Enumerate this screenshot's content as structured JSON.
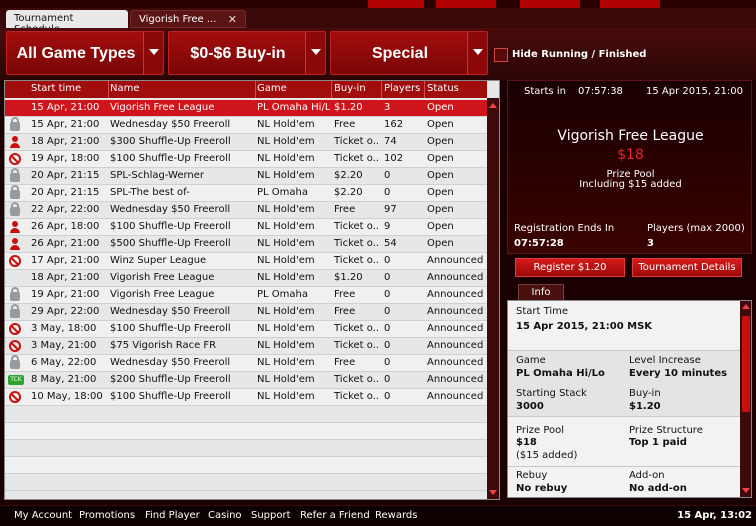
{
  "tabs": [
    {
      "label": "Tournament Schedule"
    },
    {
      "label": "Vigorish Free ..."
    }
  ],
  "filters": {
    "game_types": "All Game Types",
    "buy_in": "$0-$6 Buy-in",
    "special": "Special",
    "hide_running_label": "Hide Running / Finished",
    "hide_running_checked": false
  },
  "table": {
    "headers": [
      "Start time",
      "Name",
      "Game",
      "Buy-in",
      "Players",
      "Status"
    ],
    "rows": [
      {
        "icon": "none",
        "start": "15 Apr, 21:00",
        "name": "Vigorish Free League",
        "game": "PL Omaha Hi/Lo",
        "buyin": "$1.20",
        "players": "3",
        "status": "Open",
        "selected": true
      },
      {
        "icon": "lock-icon",
        "start": "15 Apr, 21:00",
        "name": "Wednesday $50 Freeroll",
        "game": "NL Hold'em",
        "buyin": "Free",
        "players": "162",
        "status": "Open"
      },
      {
        "icon": "person-icon",
        "start": "18 Apr, 21:00",
        "name": "$300 Shuffle-Up Freeroll",
        "game": "NL Hold'em",
        "buyin": "Ticket o...",
        "players": "74",
        "status": "Open"
      },
      {
        "icon": "ban-icon",
        "start": "19 Apr, 18:00",
        "name": "$100 Shuffle-Up Freeroll",
        "game": "NL Hold'em",
        "buyin": "Ticket o...",
        "players": "102",
        "status": "Open"
      },
      {
        "icon": "lock-icon",
        "start": "20 Apr, 21:15",
        "name": "SPL-Schlag-Werner",
        "game": "NL Hold'em",
        "buyin": "$2.20",
        "players": "0",
        "status": "Open"
      },
      {
        "icon": "lock-icon",
        "start": "20 Apr, 21:15",
        "name": "SPL-The best of-",
        "game": "PL Omaha",
        "buyin": "$2.20",
        "players": "0",
        "status": "Open"
      },
      {
        "icon": "lock-icon",
        "start": "22 Apr, 22:00",
        "name": "Wednesday $50 Freeroll",
        "game": "NL Hold'em",
        "buyin": "Free",
        "players": "97",
        "status": "Open"
      },
      {
        "icon": "person-icon",
        "start": "26 Apr, 18:00",
        "name": "$100 Shuffle-Up Freeroll",
        "game": "NL Hold'em",
        "buyin": "Ticket o...",
        "players": "9",
        "status": "Open"
      },
      {
        "icon": "person-icon",
        "start": "26 Apr, 21:00",
        "name": "$500 Shuffle-Up Freeroll",
        "game": "NL Hold'em",
        "buyin": "Ticket o...",
        "players": "54",
        "status": "Open"
      },
      {
        "icon": "ban-icon",
        "start": "17 Apr, 21:00",
        "name": "Winz Super League",
        "game": "NL Hold'em",
        "buyin": "Ticket o...",
        "players": "0",
        "status": "Announced"
      },
      {
        "icon": "none",
        "start": "18 Apr, 21:00",
        "name": "Vigorish Free League",
        "game": "NL Hold'em",
        "buyin": "$1.20",
        "players": "0",
        "status": "Announced"
      },
      {
        "icon": "lock-icon",
        "start": "19 Apr, 21:00",
        "name": "Vigorish Free League",
        "game": "PL Omaha",
        "buyin": "Free",
        "players": "0",
        "status": "Announced"
      },
      {
        "icon": "lock-icon",
        "start": "29 Apr, 22:00",
        "name": "Wednesday $50 Freeroll",
        "game": "NL Hold'em",
        "buyin": "Free",
        "players": "0",
        "status": "Announced"
      },
      {
        "icon": "ban-icon",
        "start": "3 May, 18:00",
        "name": "$100 Shuffle-Up Freeroll",
        "game": "NL Hold'em",
        "buyin": "Ticket o...",
        "players": "0",
        "status": "Announced"
      },
      {
        "icon": "ban-icon",
        "start": "3 May, 21:00",
        "name": "$75 Vigorish Race FR",
        "game": "NL Hold'em",
        "buyin": "Ticket o...",
        "players": "0",
        "status": "Announced"
      },
      {
        "icon": "lock-icon",
        "start": "6 May, 22:00",
        "name": "Wednesday $50 Freeroll",
        "game": "NL Hold'em",
        "buyin": "Free",
        "players": "0",
        "status": "Announced"
      },
      {
        "icon": "ticket-icon",
        "start": "8 May, 21:00",
        "name": "$200 Shuffle-Up Freeroll",
        "game": "NL Hold'em",
        "buyin": "Ticket o...",
        "players": "0",
        "status": "Announced"
      },
      {
        "icon": "ban-icon",
        "start": "10 May, 18:00",
        "name": "$100 Shuffle-Up Freeroll",
        "game": "NL Hold'em",
        "buyin": "Ticket o...",
        "players": "0",
        "status": "Announced"
      }
    ]
  },
  "detail": {
    "starts_in_label": "Starts in",
    "countdown": "07:57:38",
    "date": "15 Apr 2015, 21:00",
    "name": "Vigorish Free League",
    "prize_pool": "$18",
    "prize_pool_label": "Prize Pool",
    "prize_pool_included": "Including $15 added",
    "reg_ends_label": "Registration Ends In",
    "reg_ends_value": "07:57:28",
    "players_label": "Players (max 2000)",
    "players_value": "3"
  },
  "buttons": {
    "register": "Register $1.20",
    "details": "Tournament Details"
  },
  "info": {
    "tab_label": "Info",
    "start_time_label": "Start Time",
    "start_time_value": "15 Apr 2015, 21:00 MSK",
    "game_label": "Game",
    "game_value": "PL Omaha Hi/Lo",
    "level_label": "Level Increase",
    "level_value": "Every 10 minutes",
    "stack_label": "Starting Stack",
    "stack_value": "3000",
    "buyin_label": "Buy-in",
    "buyin_value": "$1.20",
    "pool_label": "Prize Pool",
    "pool_value": "$18",
    "pool_added": "($15 added)",
    "structure_label": "Prize Structure",
    "structure_value": "Top 1 paid",
    "rebuy_label": "Rebuy",
    "rebuy_value": "No rebuy",
    "addon_label": "Add-on",
    "addon_value": "No add-on"
  },
  "footer": {
    "links": [
      "My Account",
      "Promotions",
      "Find Player",
      "Casino",
      "Support",
      "Refer a Friend",
      "Rewards"
    ],
    "clock": "15 Apr, 13:02"
  },
  "colors": {
    "accent": "#c81010",
    "selected_row": "#d0141b",
    "panel_bg": "#1a0000"
  }
}
